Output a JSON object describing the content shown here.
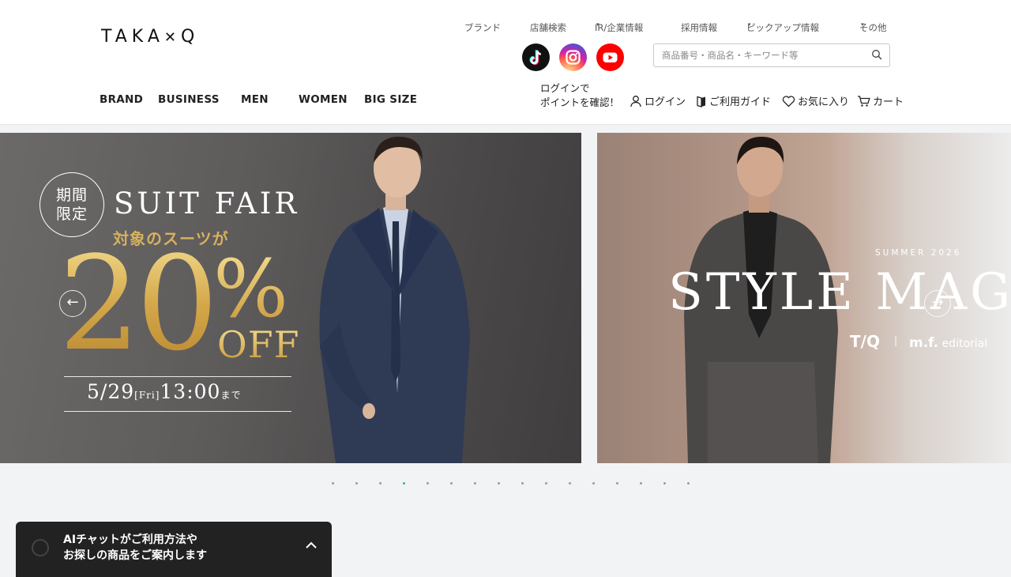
{
  "header": {
    "logo": "TAKA-Q",
    "top_nav": [
      {
        "label": "ブランド",
        "has_caret": false
      },
      {
        "label": "店舗検索",
        "has_caret": false
      },
      {
        "label": "IR/企業情報",
        "has_caret": true
      },
      {
        "label": "採用情報",
        "has_caret": false
      },
      {
        "label": "ピックアップ情報",
        "has_caret": true
      },
      {
        "label": "その他",
        "has_caret": true
      }
    ],
    "caret": "▾",
    "social": [
      "tiktok-icon",
      "instagram-icon",
      "youtube-icon"
    ],
    "search": {
      "placeholder": "商品番号・商品名・キーワード等",
      "value": ""
    },
    "main_nav": [
      "BRAND",
      "BUSINESS",
      "MEN",
      "WOMEN",
      "BIG SIZE"
    ],
    "login_promo": {
      "line1": "ログインで",
      "line2": "ポイントを確認！"
    },
    "utility": [
      {
        "icon": "user-icon",
        "label": "ログイン"
      },
      {
        "icon": "guide-book-icon",
        "label": "ご利用ガイド"
      },
      {
        "icon": "heart-icon",
        "label": "お気に入り"
      },
      {
        "icon": "cart-icon",
        "label": "カート"
      }
    ]
  },
  "carousel": {
    "slide1": {
      "badge_line1": "期間",
      "badge_line2": "限定",
      "title": "SUIT FAIR",
      "subtitle": "対象のスーツが",
      "discount": "20",
      "percent": "%",
      "off": "OFF",
      "date_main": "5/29",
      "date_day": "[Fri]",
      "date_time": "13:00",
      "date_suffix": "まで"
    },
    "slide2": {
      "season": "SUMMER 2026",
      "title": "STYLE MAGA",
      "brand1": "T/Q",
      "divider": "|",
      "brand2_bold": "m.f.",
      "brand2_rest": "editorial"
    },
    "prev_arrow": "←",
    "next_arrow": "→",
    "dot_count": 16,
    "active_dot": 3
  },
  "chat": {
    "line1": "AIチャットがご利用方法や",
    "line2": "お探しの商品をご案内します"
  },
  "colors": {
    "accent_dot": "#35b59a",
    "gold": "#d6b15e",
    "chat_bg": "#222222"
  }
}
